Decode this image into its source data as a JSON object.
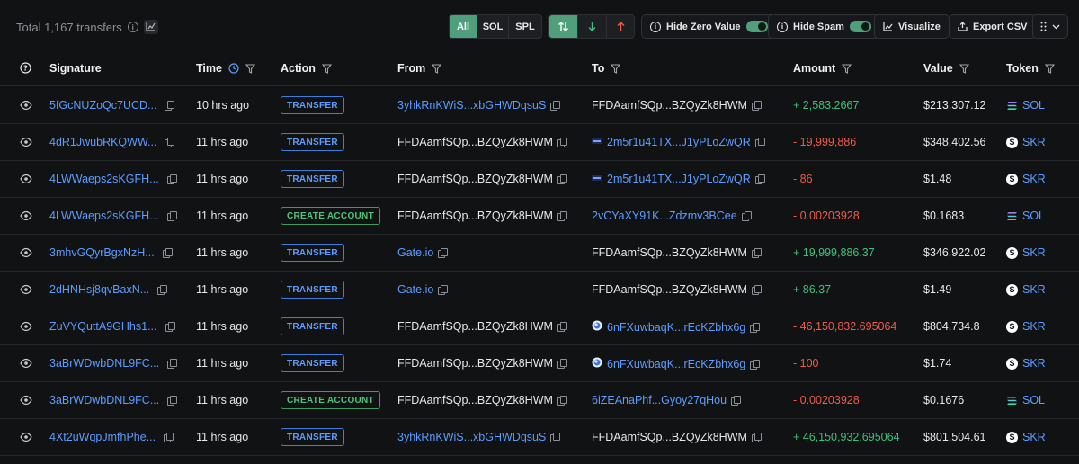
{
  "header": {
    "total_label": "Total 1,167 transfers",
    "filter_all": "All",
    "filter_sol": "SOL",
    "filter_spl": "SPL",
    "hide_zero_label": "Hide Zero Value",
    "hide_spam_label": "Hide Spam",
    "visualize_label": "Visualize",
    "export_label": "Export CSV"
  },
  "columns": {
    "signature": "Signature",
    "time": "Time",
    "action": "Action",
    "from": "From",
    "to": "To",
    "amount": "Amount",
    "value": "Value",
    "token": "Token"
  },
  "colors": {
    "accent": "#4f9e7c",
    "link": "#5c9dff",
    "positive": "#3fbf7f",
    "negative": "#ef5a4c"
  },
  "rows": [
    {
      "signature": "5fGcNUZoQc7UCD...",
      "time": "10 hrs ago",
      "action": "TRANSFER",
      "from": "3yhkRnKWiS...xbGHWDqsuS",
      "to": "FFDAamfSQp...BZQyZk8HWM",
      "amount": "+ 2,583.2667",
      "value": "$213,307.12",
      "token": "SOL"
    },
    {
      "signature": "4dR1JwubRKQWW...",
      "time": "11 hrs ago",
      "action": "TRANSFER",
      "from": "FFDAamfSQp...BZQyZk8HWM",
      "to": "2m5r1u41TX...J1yPLoZwQR",
      "amount": "- 19,999,886",
      "value": "$348,402.56",
      "token": "SKR"
    },
    {
      "signature": "4LWWaeps2sKGFH...",
      "time": "11 hrs ago",
      "action": "TRANSFER",
      "from": "FFDAamfSQp...BZQyZk8HWM",
      "to": "2m5r1u41TX...J1yPLoZwQR",
      "amount": "- 86",
      "value": "$1.48",
      "token": "SKR"
    },
    {
      "signature": "4LWWaeps2sKGFH...",
      "time": "11 hrs ago",
      "action": "CREATE ACCOUNT",
      "from": "FFDAamfSQp...BZQyZk8HWM",
      "to": "2vCYaXY91K...Zdzmv3BCee",
      "amount": "- 0.00203928",
      "value": "$0.1683",
      "token": "SOL"
    },
    {
      "signature": "3mhvGQyrBgxNzH...",
      "time": "11 hrs ago",
      "action": "TRANSFER",
      "from": "Gate.io",
      "to": "FFDAamfSQp...BZQyZk8HWM",
      "amount": "+ 19,999,886.37",
      "value": "$346,922.02",
      "token": "SKR"
    },
    {
      "signature": "2dHNHsj8qvBaxN...",
      "time": "11 hrs ago",
      "action": "TRANSFER",
      "from": "Gate.io",
      "to": "FFDAamfSQp...BZQyZk8HWM",
      "amount": "+ 86.37",
      "value": "$1.49",
      "token": "SKR"
    },
    {
      "signature": "ZuVYQuttA9GHhs1...",
      "time": "11 hrs ago",
      "action": "TRANSFER",
      "from": "FFDAamfSQp...BZQyZk8HWM",
      "to": "6nFXuwbaqK...rEcKZbhx6g",
      "amount": "- 46,150,832.695064",
      "value": "$804,734.8",
      "token": "SKR"
    },
    {
      "signature": "3aBrWDwbDNL9FC...",
      "time": "11 hrs ago",
      "action": "TRANSFER",
      "from": "FFDAamfSQp...BZQyZk8HWM",
      "to": "6nFXuwbaqK...rEcKZbhx6g",
      "amount": "- 100",
      "value": "$1.74",
      "token": "SKR"
    },
    {
      "signature": "3aBrWDwbDNL9FC...",
      "time": "11 hrs ago",
      "action": "CREATE ACCOUNT",
      "from": "FFDAamfSQp...BZQyZk8HWM",
      "to": "6iZEAnaPhf...Gyoy27qHou",
      "amount": "- 0.00203928",
      "value": "$0.1676",
      "token": "SOL"
    },
    {
      "signature": "4Xt2uWqpJmfhPhe...",
      "time": "11 hrs ago",
      "action": "TRANSFER",
      "from": "3yhkRnKWiS...xbGHWDqsuS",
      "to": "FFDAamfSQp...BZQyZk8HWM",
      "amount": "+ 46,150,932.695064",
      "value": "$801,504.61",
      "token": "SKR"
    }
  ]
}
